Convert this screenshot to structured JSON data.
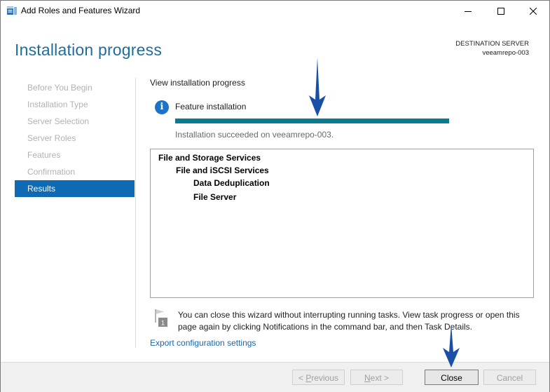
{
  "window": {
    "title": "Add Roles and Features Wizard"
  },
  "header": {
    "page_title": "Installation progress",
    "destination_label": "DESTINATION SERVER",
    "destination_server": "veeamrepo-003"
  },
  "nav": {
    "items": [
      {
        "label": "Before You Begin",
        "active": false
      },
      {
        "label": "Installation Type",
        "active": false
      },
      {
        "label": "Server Selection",
        "active": false
      },
      {
        "label": "Server Roles",
        "active": false
      },
      {
        "label": "Features",
        "active": false
      },
      {
        "label": "Confirmation",
        "active": false
      },
      {
        "label": "Results",
        "active": true
      }
    ]
  },
  "main": {
    "section_title": "View installation progress",
    "feature_label": "Feature installation",
    "progress": 1.0,
    "status_text": "Installation succeeded on veeamrepo-003.",
    "results": [
      {
        "label": "File and Storage Services",
        "level": 0
      },
      {
        "label": "File and iSCSI Services",
        "level": 1
      },
      {
        "label": "Data Deduplication",
        "level": 2
      },
      {
        "label": "File Server",
        "level": 2
      }
    ],
    "notice_badge": "1",
    "notice_text": "You can close this wizard without interrupting running tasks. View task progress or open this page again by clicking Notifications in the command bar, and then Task Details.",
    "export_link": "Export configuration settings"
  },
  "footer": {
    "previous": {
      "prefix": "< ",
      "key": "P",
      "rest": "revious"
    },
    "next": {
      "key": "N",
      "rest": "ext >"
    },
    "close": "Close",
    "cancel": "Cancel"
  },
  "colors": {
    "accent_title": "#1f6d9b",
    "nav_active": "#0e6ab3",
    "progress_fill": "#0a7b8e",
    "arrow": "#1a4fa8"
  },
  "icons": {
    "app": "server-manager-icon",
    "info": "info-icon",
    "notice": "flag-notification-icon"
  }
}
